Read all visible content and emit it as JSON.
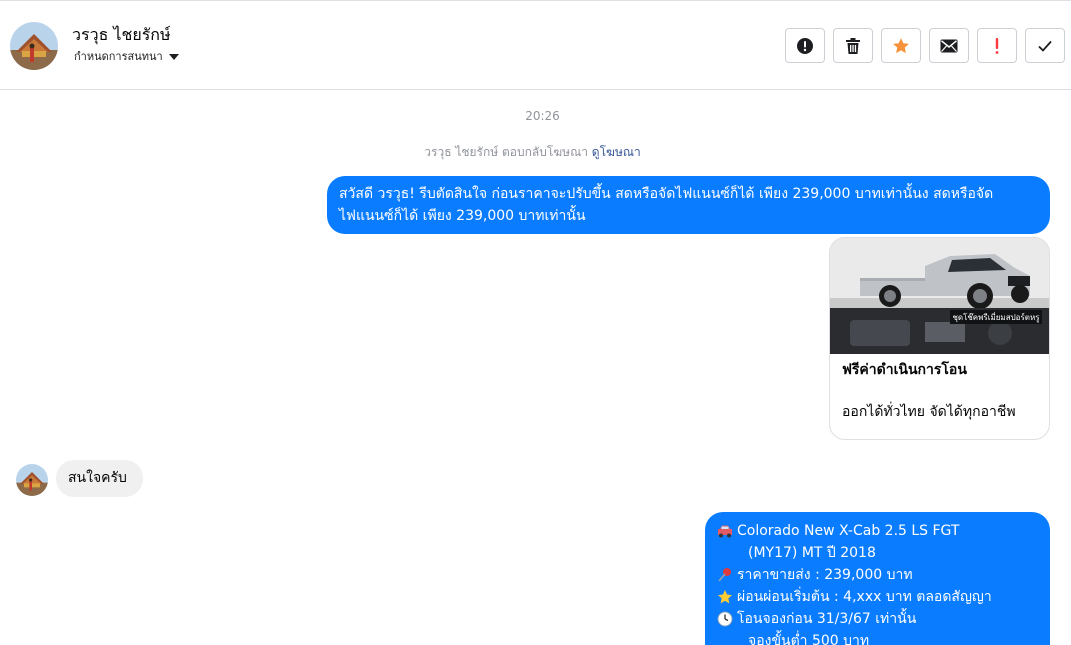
{
  "header": {
    "contact_name": "วรวุธ ไชยรักษ์",
    "assign_label": "กำหนดการสนทนา",
    "actions": [
      {
        "icon": "exclamation-circle-icon"
      },
      {
        "icon": "trash-icon"
      },
      {
        "icon": "star-icon",
        "color": "#f7923b"
      },
      {
        "icon": "envelope-icon"
      },
      {
        "icon": "exclamation-mark-icon",
        "color": "#fa383e"
      },
      {
        "icon": "checkmark-icon"
      }
    ]
  },
  "thread": {
    "timestamp": "20:26",
    "ad_reply": {
      "text": "วรวุธ ไชยรักษ์ ตอบกลับโฆษณา",
      "link": "ดูโฆษณา"
    },
    "messages": [
      {
        "direction": "outgoing",
        "text": "สวัสดี วรวุธ! รีบตัดสินใจ ก่อนราคาจะปรับขึ้น สดหรือจัดไฟแนนซ์ก็ได้  เพียง 239,000 บาทเท่านั้นง สดหรือจัดไฟแนนซ์ก็ได้  เพียง 239,000 บาทเท่านั้น"
      },
      {
        "direction": "outgoing",
        "type": "ad_card",
        "title": "ฟรีค่าดำเนินการโอน",
        "description": "ออกได้ทั่วไทย จัดได้ทุกอาชีพ",
        "image_caption": "ชุดโช๊คพรีเมี่ยมสปอร์ตหรู"
      },
      {
        "direction": "incoming",
        "text": "สนใจครับ"
      },
      {
        "direction": "outgoing",
        "lines": [
          {
            "icon": "car-icon",
            "text": "Colorado New X-Cab 2.5 LS FGT"
          },
          {
            "icon": "",
            "text": "(MY17) MT ปี 2018"
          },
          {
            "icon": "pushpin-icon",
            "text": "ราคาขายส่ง : 239,000 บาท"
          },
          {
            "icon": "star-icon",
            "text": "ผ่อนผ่อนเริ่มต้น : 4,xxx บาท ตลอดสัญญา"
          },
          {
            "icon": "clock-icon",
            "text": "โอนจองก่อน 31/3/67 เท่านั้น"
          },
          {
            "icon": "",
            "text": "จองขั้นต่ำ 500 บาท"
          }
        ]
      }
    ]
  },
  "colors": {
    "outgoing_bubble": "#0a7cff",
    "incoming_bubble": "#f0f0f0",
    "link": "#385898",
    "meta_text": "#90949c"
  }
}
